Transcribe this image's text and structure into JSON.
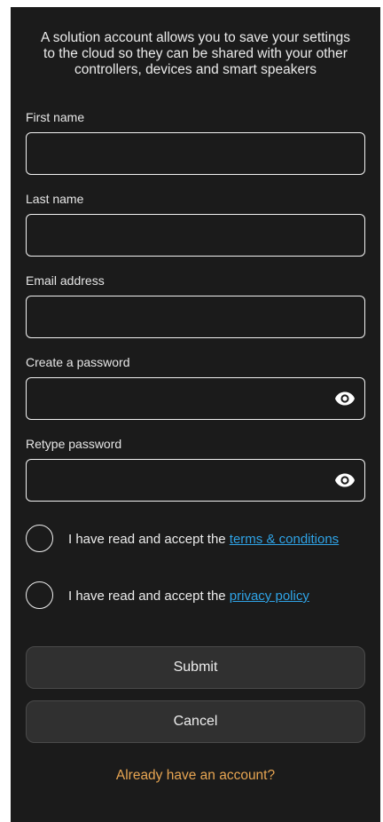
{
  "intro": {
    "line1": "A solution account allows you to save your settings",
    "line2": "to the cloud so they can be shared with your other",
    "line3": "controllers, devices and smart speakers"
  },
  "form": {
    "first_name": {
      "label": "First name",
      "value": ""
    },
    "last_name": {
      "label": "Last name",
      "value": ""
    },
    "email": {
      "label": "Email address",
      "value": ""
    },
    "password": {
      "label": "Create a password",
      "value": "",
      "icon": "eye-icon"
    },
    "retype_password": {
      "label": "Retype password",
      "value": "",
      "icon": "eye-icon"
    }
  },
  "consents": {
    "terms": {
      "prefix": "I have read and accept the ",
      "link": "terms & conditions",
      "checked": false
    },
    "privacy": {
      "prefix": "I have read and accept the ",
      "link": "privacy policy",
      "checked": false
    }
  },
  "buttons": {
    "submit": "Submit",
    "cancel": "Cancel"
  },
  "login_link": "Already have an account?",
  "colors": {
    "background": "#1b1b1b",
    "link": "#2fa3e6",
    "accent": "#e7a552",
    "button": "#303030"
  }
}
